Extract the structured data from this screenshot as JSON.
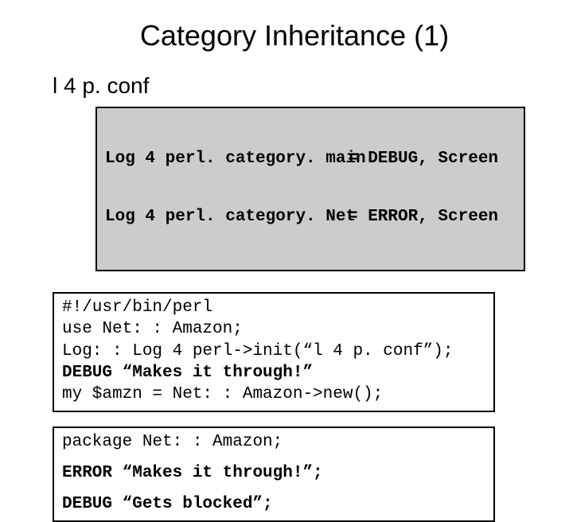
{
  "title": "Category Inheritance (1)",
  "subtitle": "l 4 p. conf",
  "conf": {
    "rows": [
      {
        "left": "Log 4 perl. category. main",
        "right": "= DEBUG, Screen"
      },
      {
        "left": "Log 4 perl. category. Net",
        "right": "= ERROR, Screen"
      }
    ]
  },
  "script": {
    "lines": [
      {
        "text": "#!/usr/bin/perl",
        "bold": false
      },
      {
        "text": "use Net: : Amazon;",
        "bold": false
      },
      {
        "text": "Log: : Log 4 perl->init(“l 4 p. conf”);",
        "bold": false
      },
      {
        "text": "DEBUG “Makes it through!”",
        "bold": true
      },
      {
        "text": "my $amzn = Net: : Amazon->new();",
        "bold": false
      }
    ]
  },
  "pkg": {
    "lines": [
      {
        "text": "package Net: : Amazon;",
        "bold": false,
        "spaced": false
      },
      {
        "text": "ERROR “Makes it through!”;",
        "bold": true,
        "spaced": true
      },
      {
        "text": "DEBUG “Gets blocked”;",
        "bold": true,
        "spaced": true
      }
    ]
  }
}
